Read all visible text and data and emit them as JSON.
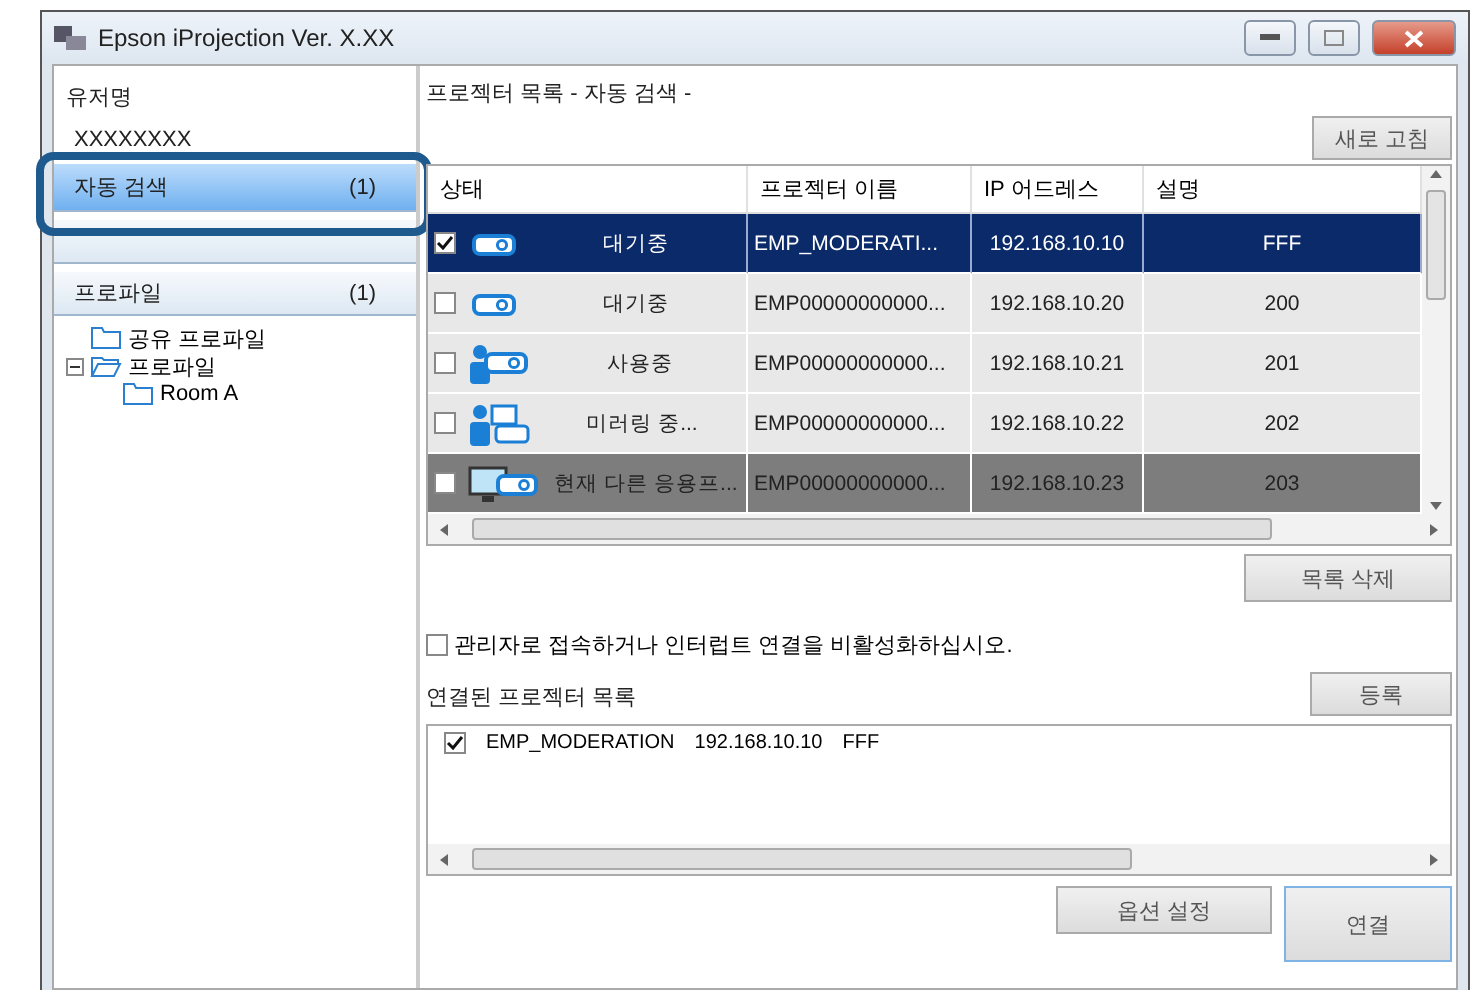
{
  "window": {
    "title": "Epson iProjection Ver. X.XX"
  },
  "sidebar": {
    "user_label": "유저명",
    "user_name": "XXXXXXXX",
    "items": [
      {
        "label": "자동 검색",
        "count": "(1)",
        "selected": true
      },
      {
        "selected": false
      },
      {
        "label": "프로파일",
        "count": "(1)",
        "selected": false
      }
    ],
    "tree": [
      {
        "label": "공유 프로파일"
      },
      {
        "label": "프로파일",
        "expanded": true,
        "children": [
          {
            "label": "Room A"
          }
        ]
      }
    ]
  },
  "projector_list": {
    "heading": "프로젝터 목록 - 자동 검색 -",
    "refresh_button": "새로 고침",
    "columns": [
      "상태",
      "프로젝터 이름",
      "IP 어드레스",
      "설명"
    ],
    "rows": [
      {
        "checked": true,
        "kind": "projector",
        "status": "대기중",
        "name": "EMP_MODERATI...",
        "ip": "192.168.10.10",
        "description": "FFF",
        "selected": true,
        "busy": false
      },
      {
        "checked": false,
        "kind": "projector",
        "status": "대기중",
        "name": "EMP00000000000...",
        "ip": "192.168.10.20",
        "description": "200",
        "selected": false,
        "busy": false
      },
      {
        "checked": false,
        "kind": "user",
        "status": "사용중",
        "name": "EMP00000000000...",
        "ip": "192.168.10.21",
        "description": "201",
        "selected": false,
        "busy": false
      },
      {
        "checked": false,
        "kind": "mirroring",
        "status": "미러링 중...",
        "name": "EMP00000000000...",
        "ip": "192.168.10.22",
        "description": "202",
        "selected": false,
        "busy": false
      },
      {
        "checked": false,
        "kind": "other-app",
        "status": "현재 다른 응용프...",
        "name": "EMP00000000000...",
        "ip": "192.168.10.23",
        "description": "203",
        "selected": false,
        "busy": true
      }
    ],
    "delete_button": "목록 삭제"
  },
  "admin_option": {
    "label": "관리자로 접속하거나 인터럽트 연결을 비활성화하십시오.",
    "checked": false
  },
  "connected": {
    "heading": "연결된 프로젝터 목록",
    "register_button": "등록",
    "rows": [
      {
        "checked": true,
        "name": "EMP_MODERATION",
        "ip": "192.168.10.10",
        "description": "FFF"
      }
    ]
  },
  "buttons": {
    "options": "옵션 설정",
    "connect": "연결"
  }
}
